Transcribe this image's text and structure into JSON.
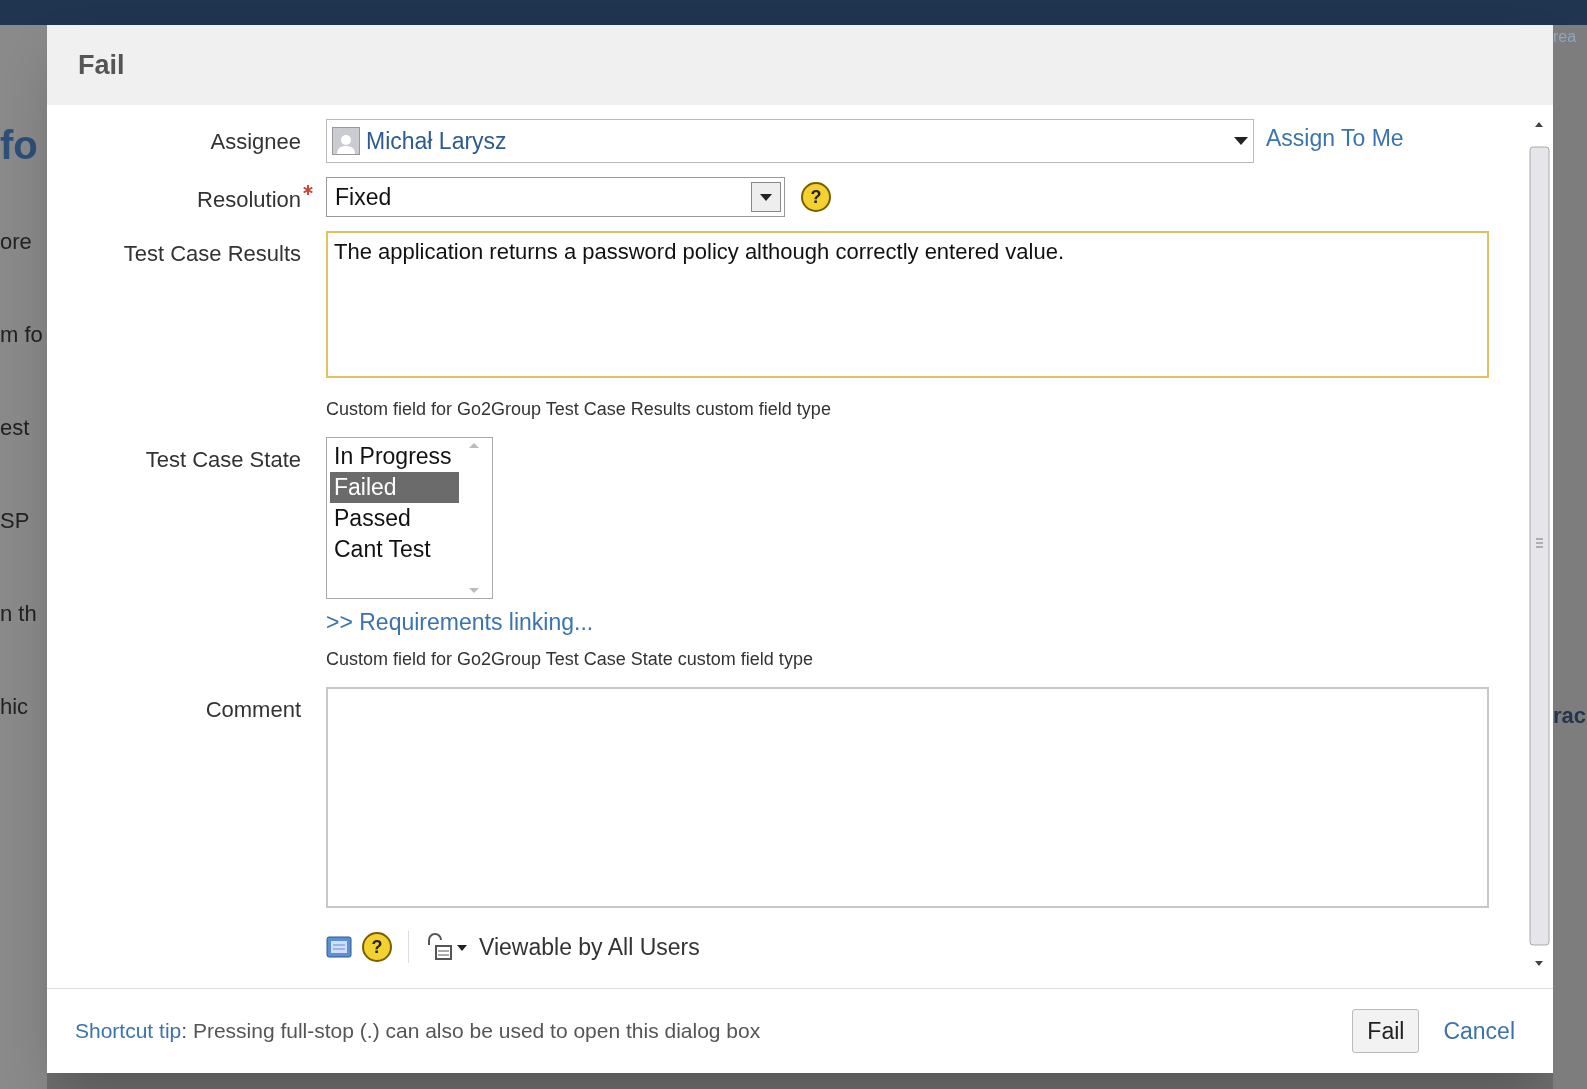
{
  "background": {
    "left_fragments": [
      "fo",
      "ore",
      "m fo",
      "est",
      "SP",
      "n th",
      "hic"
    ],
    "right_fragments": [
      "rea",
      "rac"
    ]
  },
  "dialog": {
    "title": "Fail",
    "fields": [
      {
        "kind": "user",
        "label": "Assignee",
        "required": false,
        "value": "Michał Larysz",
        "link": "Assign To Me"
      },
      {
        "kind": "select",
        "label": "Resolution",
        "required": true,
        "value": "Fixed",
        "help_icon": "?"
      },
      {
        "kind": "textarea",
        "label": "Test Case Results",
        "required": false,
        "focused": true,
        "value": "The application returns a password policy although correctly entered value.",
        "description": "Custom field for Go2Group Test Case Results custom field type"
      },
      {
        "kind": "listbox",
        "label": "Test Case State",
        "required": false,
        "options": [
          {
            "label": "In Progress",
            "selected": false
          },
          {
            "label": "Failed",
            "selected": true
          },
          {
            "label": "Passed",
            "selected": false
          },
          {
            "label": "Cant Test",
            "selected": false
          }
        ],
        "link": ">> Requirements linking...",
        "description": "Custom field for Go2Group Test Case State custom field type"
      },
      {
        "kind": "textarea",
        "label": "Comment",
        "required": false,
        "focused": false,
        "help_icon": "?",
        "visibility": "Viewable by All Users"
      }
    ]
  },
  "footer": {
    "tip_link": "Shortcut tip",
    "tip_text": ": Pressing full-stop (.) can also be used to open this dialog box",
    "buttons": [
      "Fail"
    ],
    "cancel": "Cancel"
  }
}
